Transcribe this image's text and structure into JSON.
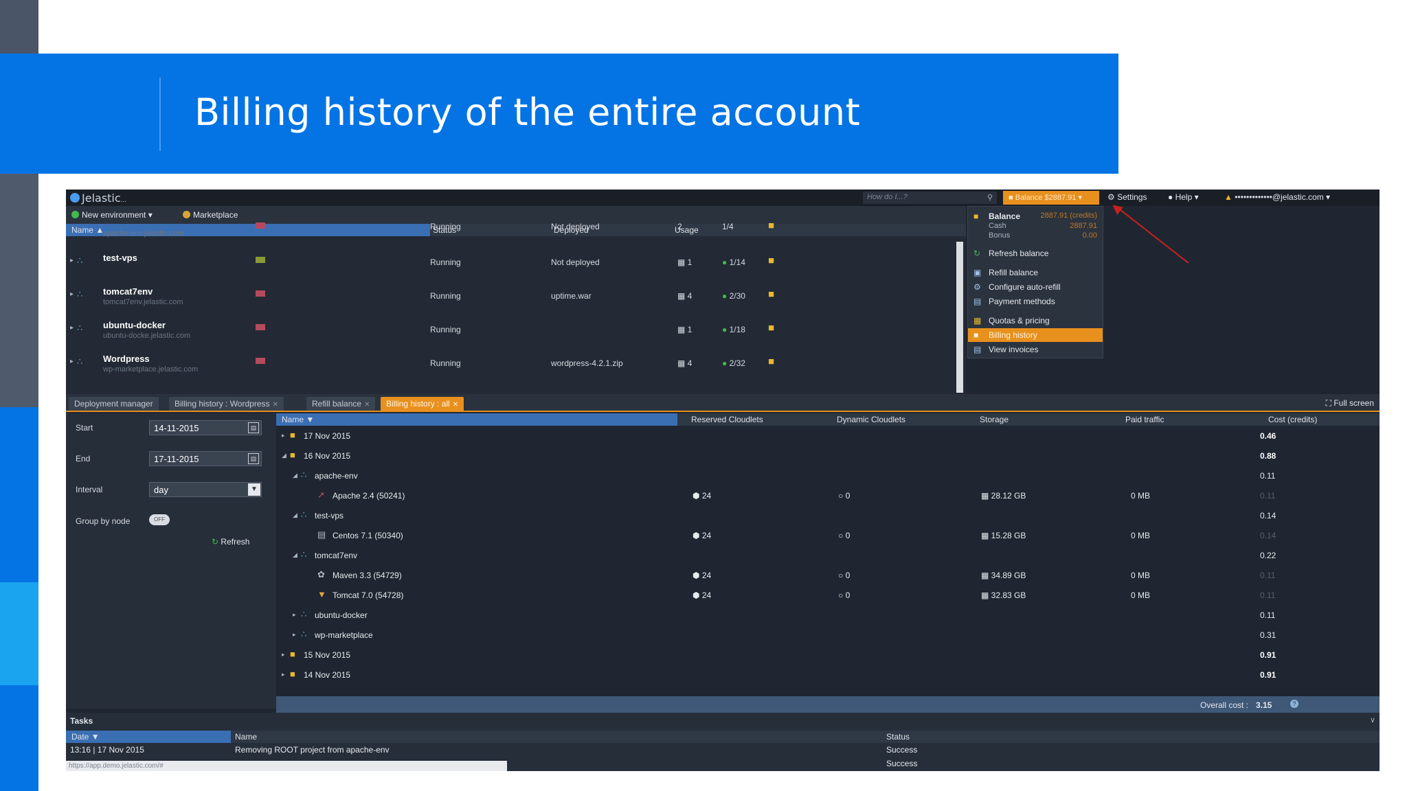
{
  "slide": {
    "title": "Billing history of the entire account"
  },
  "app": {
    "logo": "Jelastic",
    "logo_suffix": "...",
    "search_placeholder": "How do I...?",
    "balance_button": "Balance $2887.91",
    "settings": "Settings",
    "help": "Help",
    "user": "•••••••••••••@jelastic.com",
    "new_environment": "New environment",
    "marketplace": "Marketplace"
  },
  "env_table": {
    "headers": {
      "name": "Name",
      "status": "Status",
      "deployed": "Deployed",
      "usage": "Usage"
    },
    "partial_row": {
      "domain": "apache-env.jelastic.com",
      "status": "Running",
      "deployed": "Not deployed",
      "nodes": "2",
      "cloudlets": "1/4"
    },
    "rows": [
      {
        "name": "test-vps",
        "domain": "",
        "status": "Running",
        "deployed": "Not deployed",
        "nodes": "1",
        "cloudlets": "1/14"
      },
      {
        "name": "tomcat7env",
        "domain": "tomcat7env.jelastic.com",
        "status": "Running",
        "deployed": "uptime.war",
        "nodes": "4",
        "cloudlets": "2/30"
      },
      {
        "name": "ubuntu-docker",
        "domain": "ubuntu-docke.jelastic.com",
        "status": "Running",
        "deployed": "",
        "nodes": "1",
        "cloudlets": "1/18"
      },
      {
        "name": "Wordpress",
        "domain": "wp-marketplace.jelastic.com",
        "status": "Running",
        "deployed": "wordpress-4.2.1.zip",
        "nodes": "4",
        "cloudlets": "2/32"
      }
    ]
  },
  "balance_menu": {
    "balance": "Balance",
    "balance_value": "2887.91 (credits)",
    "cash": "Cash",
    "cash_value": "2887.91",
    "bonus": "Bonus",
    "bonus_value": "0.00",
    "items": [
      "Refresh balance",
      "Refill balance",
      "Configure auto-refill",
      "Payment methods",
      "Quotas & pricing",
      "Billing history",
      "View invoices"
    ]
  },
  "tabs": {
    "items": [
      "Deployment manager",
      "Billing history : Wordpress",
      "Refill balance",
      "Billing history : all"
    ],
    "fullscreen": "Full screen"
  },
  "filter": {
    "start_label": "Start",
    "start_value": "14-11-2015",
    "end_label": "End",
    "end_value": "17-11-2015",
    "interval_label": "Interval",
    "interval_value": "day",
    "group_label": "Group by node",
    "toggle": "OFF",
    "refresh": "Refresh"
  },
  "billing": {
    "headers": {
      "name": "Name",
      "reserved": "Reserved Cloudlets",
      "dynamic": "Dynamic Cloudlets",
      "storage": "Storage",
      "traffic": "Paid traffic",
      "cost": "Cost (credits)"
    },
    "rows": [
      {
        "name": "17 Nov 2015",
        "rc": "",
        "dc": "",
        "st": "",
        "pt": "",
        "cost": "0.46"
      },
      {
        "name": "16 Nov 2015",
        "rc": "",
        "dc": "",
        "st": "",
        "pt": "",
        "cost": "0.88"
      },
      {
        "name": "apache-env",
        "rc": "",
        "dc": "",
        "st": "",
        "pt": "",
        "cost": "0.11"
      },
      {
        "name": "Apache 2.4 (50241)",
        "rc": "24",
        "dc": "0",
        "st": "28.12 GB",
        "pt": "0 MB",
        "cost": "0.11"
      },
      {
        "name": "test-vps",
        "rc": "",
        "dc": "",
        "st": "",
        "pt": "",
        "cost": "0.14"
      },
      {
        "name": "Centos 7.1 (50340)",
        "rc": "24",
        "dc": "0",
        "st": "15.28 GB",
        "pt": "0 MB",
        "cost": "0.14"
      },
      {
        "name": "tomcat7env",
        "rc": "",
        "dc": "",
        "st": "",
        "pt": "",
        "cost": "0.22"
      },
      {
        "name": "Maven 3.3 (54729)",
        "rc": "24",
        "dc": "0",
        "st": "34.89 GB",
        "pt": "0 MB",
        "cost": "0.11"
      },
      {
        "name": "Tomcat 7.0 (54728)",
        "rc": "24",
        "dc": "0",
        "st": "32.83 GB",
        "pt": "0 MB",
        "cost": "0.11"
      },
      {
        "name": "ubuntu-docker",
        "rc": "",
        "dc": "",
        "st": "",
        "pt": "",
        "cost": "0.11"
      },
      {
        "name": "wp-marketplace",
        "rc": "",
        "dc": "",
        "st": "",
        "pt": "",
        "cost": "0.31"
      },
      {
        "name": "15 Nov 2015",
        "rc": "",
        "dc": "",
        "st": "",
        "pt": "",
        "cost": "0.91"
      },
      {
        "name": "14 Nov 2015",
        "rc": "",
        "dc": "",
        "st": "",
        "pt": "",
        "cost": "0.91"
      }
    ],
    "overall_label": "Overall cost :",
    "overall_value": "3.15"
  },
  "tasks": {
    "title": "Tasks",
    "headers": {
      "date": "Date",
      "name": "Name",
      "status": "Status"
    },
    "rows": [
      {
        "date": "13:16 | 17 Nov 2015",
        "name": "Removing ROOT project from apache-env",
        "status": "Success"
      },
      {
        "date": "",
        "name": "",
        "status": "Success"
      }
    ],
    "status_url": "https://app.demo.jelastic.com/#"
  }
}
